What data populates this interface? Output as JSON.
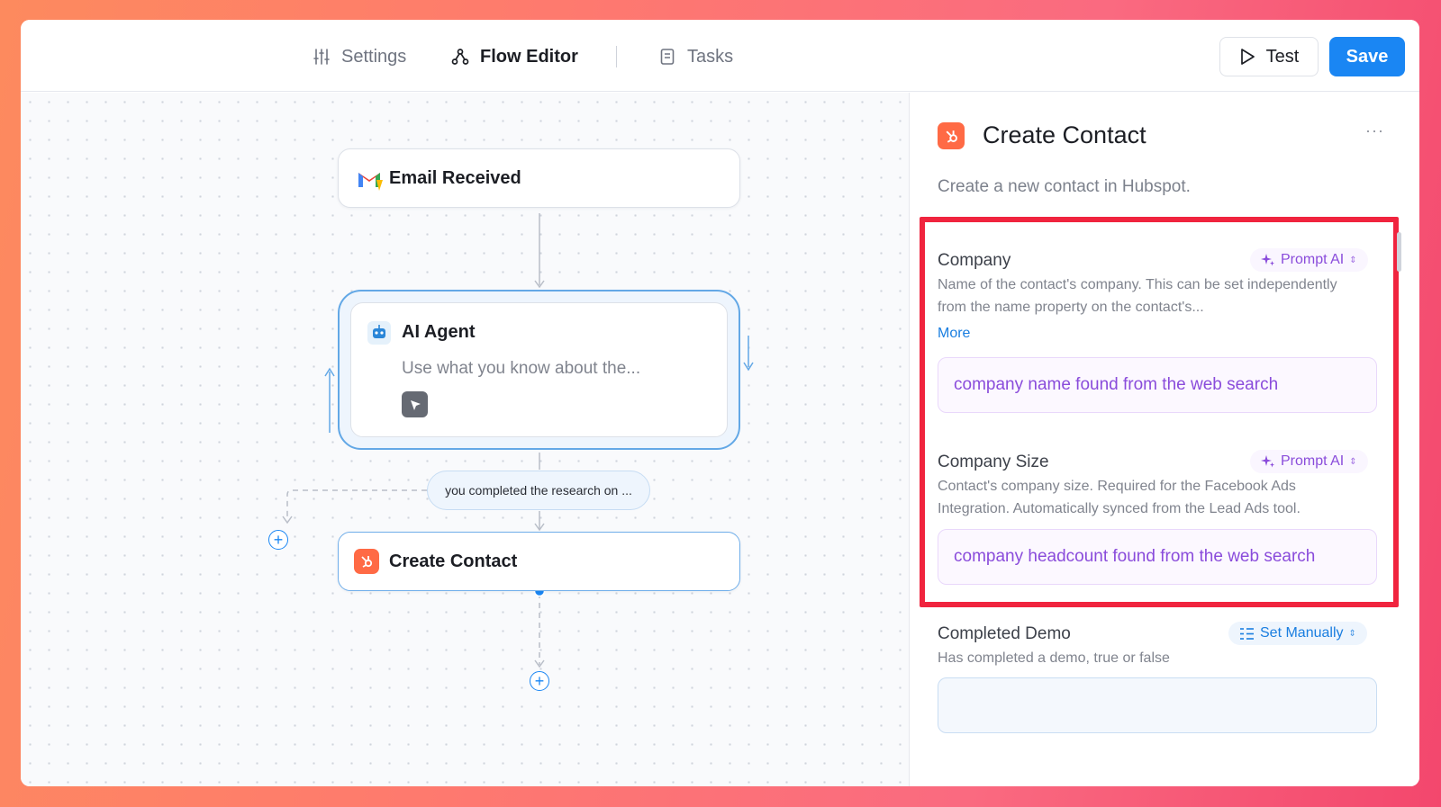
{
  "topbar": {
    "tabs": [
      {
        "label": "Settings",
        "icon": "sliders-icon"
      },
      {
        "label": "Flow Editor",
        "icon": "flow-icon"
      },
      {
        "label": "Tasks",
        "icon": "document-icon"
      }
    ],
    "test_label": "Test",
    "save_label": "Save"
  },
  "flow": {
    "trigger": {
      "title": "Email Received",
      "icon": "gmail-icon"
    },
    "agent": {
      "title": "AI Agent",
      "subtitle": "Use what you know about the...",
      "icon": "robot-icon"
    },
    "condition": {
      "label": "you completed the research on ..."
    },
    "action": {
      "title": "Create Contact",
      "icon": "hubspot-icon"
    }
  },
  "panel": {
    "title": "Create Contact",
    "description": "Create a new contact in Hubspot.",
    "more_menu": "···",
    "fields": [
      {
        "label": "Company",
        "mode": "Prompt AI",
        "help": "Name of the contact's company. This can be set independently from the name property on the contact's...",
        "more_label": "More",
        "value": "company name found from the web search"
      },
      {
        "label": "Company Size",
        "mode": "Prompt AI",
        "help": "Contact's company size. Required for the Facebook Ads Integration. Automatically synced from the Lead Ads tool.",
        "value": "company headcount found from the web search"
      },
      {
        "label": "Completed Demo",
        "mode": "Set Manually",
        "help": "Has completed a demo, true or false",
        "value": ""
      }
    ]
  },
  "colors": {
    "accent": "#1a86f3",
    "prompt_ai": "#8a4cdb",
    "highlight": "#f0243e",
    "hubspot": "#ff5c35"
  }
}
